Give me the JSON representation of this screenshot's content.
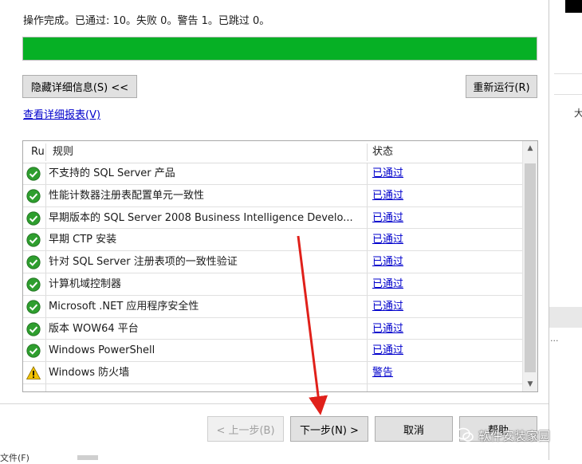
{
  "status_line": "操作完成。已通过: 10。失败 0。警告 1。已跳过 0。",
  "progress": {
    "fraction": 1.0,
    "color": "#06b025"
  },
  "buttons": {
    "hide_details": "隐藏详细信息(S) <<",
    "rerun": "重新运行(R)",
    "prev": "< 上一步(B)",
    "next": "下一步(N) >",
    "cancel": "取消",
    "help": "帮助"
  },
  "report_link": "查看详细报表(V)",
  "table": {
    "headers": {
      "ru": "Ru",
      "rule": "规则",
      "status": "状态"
    },
    "rows": [
      {
        "icon": "pass-check-icon",
        "name": "不支持的 SQL Server 产品",
        "status": "已通过"
      },
      {
        "icon": "pass-check-icon",
        "name": "性能计数器注册表配置单元一致性",
        "status": "已通过"
      },
      {
        "icon": "pass-check-icon",
        "name": "早期版本的 SQL Server 2008 Business Intelligence Develo...",
        "status": "已通过"
      },
      {
        "icon": "pass-check-icon",
        "name": "早期 CTP 安装",
        "status": "已通过"
      },
      {
        "icon": "pass-check-icon",
        "name": "针对 SQL Server 注册表项的一致性验证",
        "status": "已通过"
      },
      {
        "icon": "pass-check-icon",
        "name": "计算机域控制器",
        "status": "已通过"
      },
      {
        "icon": "pass-check-icon",
        "name": "Microsoft .NET 应用程序安全性",
        "status": "已通过"
      },
      {
        "icon": "pass-check-icon",
        "name": "版本 WOW64 平台",
        "status": "已通过"
      },
      {
        "icon": "pass-check-icon",
        "name": "Windows PowerShell",
        "status": "已通过"
      },
      {
        "icon": "warning-triangle-icon",
        "name": "Windows 防火墙",
        "status": "警告"
      }
    ]
  },
  "colors": {
    "pass": "#2e9e2e",
    "warning": "#f2c200",
    "link": "#0000cc",
    "arrow": "#e0201a"
  },
  "background": {
    "right_char": "大",
    "dots": "...",
    "bottom_left": "文件(F)"
  },
  "watermark": "软件安装家园"
}
